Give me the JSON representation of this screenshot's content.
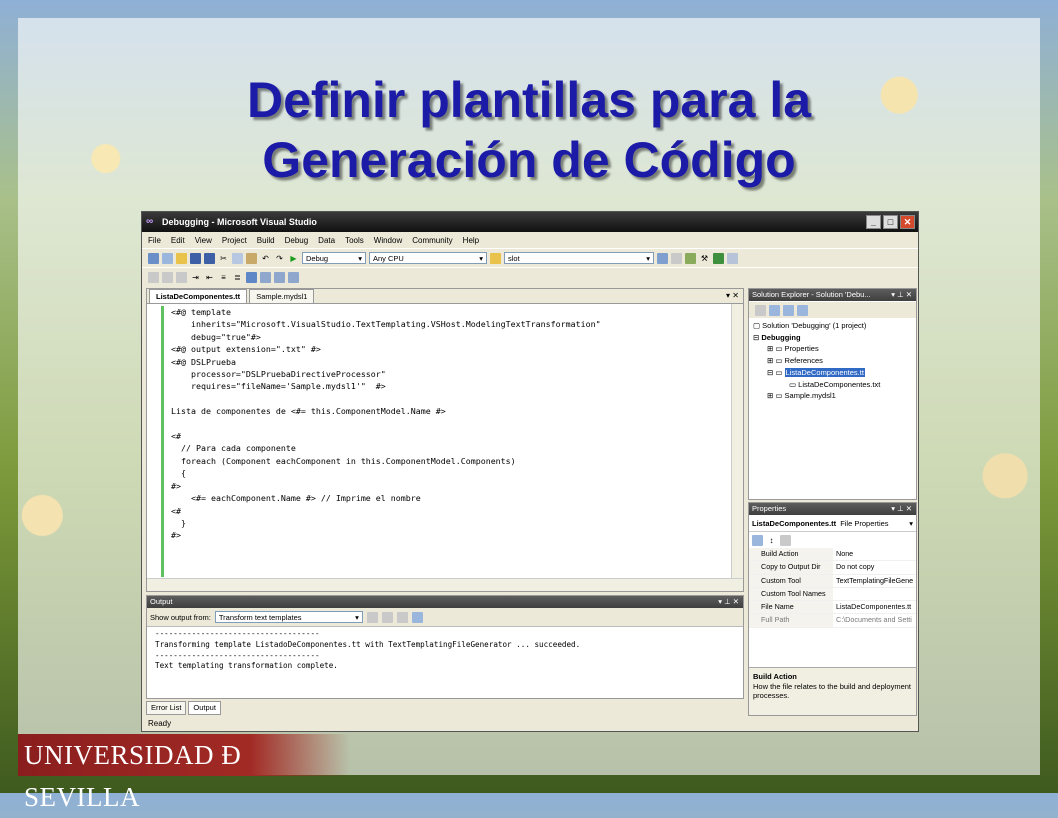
{
  "title": {
    "line1": "Definir plantillas para la",
    "line2": "Generación de Código"
  },
  "window": {
    "title": "Debugging - Microsoft Visual Studio",
    "menu": [
      "File",
      "Edit",
      "View",
      "Project",
      "Build",
      "Debug",
      "Data",
      "Tools",
      "Window",
      "Community",
      "Help"
    ],
    "toolbar": {
      "config": "Debug",
      "platform": "Any CPU",
      "find": "slot"
    }
  },
  "editor": {
    "tabs": [
      "ListaDeComponentes.tt",
      "Sample.mydsl1"
    ],
    "lines": [
      "<#@ template",
      "    inherits=\"Microsoft.VisualStudio.TextTemplating.VSHost.ModelingTextTransformation\"",
      "    debug=\"true\"#>",
      "<#@ output extension=\".txt\" #>",
      "<#@ DSLPrueba",
      "    processor=\"DSLPruebaDirectiveProcessor\"",
      "    requires=\"fileName='Sample.mydsl1'\"  #>",
      "",
      "Lista de componentes de <#= this.ComponentModel.Name #>",
      "",
      "<#",
      "  // Para cada componente",
      "  foreach (Component eachComponent in this.ComponentModel.Components)",
      "  {",
      "#>",
      "    <#= eachComponent.Name #> // Imprime el nombre",
      "<#",
      "  }",
      "#>"
    ]
  },
  "solution_explorer": {
    "title": "Solution Explorer - Solution 'Debu...",
    "items": [
      "Solution 'Debugging' (1 project)",
      "Debugging",
      "Properties",
      "References",
      "ListaDeComponentes.tt",
      "ListaDeComponentes.txt",
      "Sample.mydsl1"
    ]
  },
  "properties": {
    "title": "Properties",
    "object": "ListaDeComponentes.tt",
    "object_type": "File Properties",
    "rows": [
      {
        "k": "Build Action",
        "v": "None"
      },
      {
        "k": "Copy to Output Dir",
        "v": "Do not copy"
      },
      {
        "k": "Custom Tool",
        "v": "TextTemplatingFileGene"
      },
      {
        "k": "Custom Tool Names",
        "v": ""
      },
      {
        "k": "File Name",
        "v": "ListaDeComponentes.tt"
      },
      {
        "k": "Full Path",
        "v": "C:\\Documents and Setti"
      }
    ],
    "desc_title": "Build Action",
    "desc_text": "How the file relates to the build and deployment processes."
  },
  "output": {
    "title": "Output",
    "show_from_label": "Show output from:",
    "show_from_value": "Transform text templates",
    "lines": [
      "------------------------------------",
      "Transforming template ListadoDeComponentes.tt with TextTemplatingFileGenerator ... succeeded.",
      "------------------------------------",
      "Text templating transformation complete."
    ]
  },
  "bottom_tabs": [
    "Error List",
    "Output"
  ],
  "status": "Ready",
  "footer": "UNIVERSIDAD Ð SEVILLA"
}
